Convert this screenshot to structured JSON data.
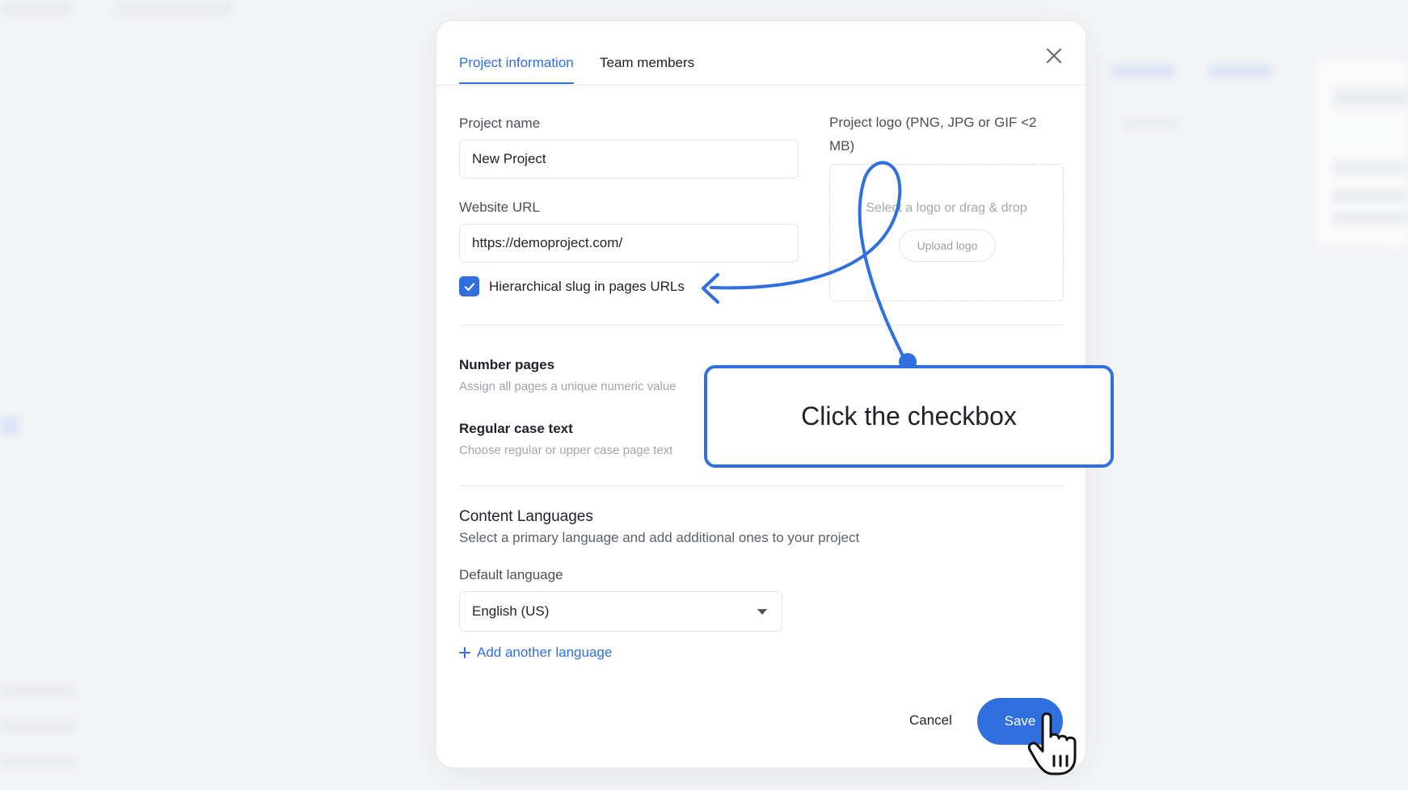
{
  "tabs": [
    {
      "label": "Project information",
      "active": true
    },
    {
      "label": "Team members",
      "active": false
    }
  ],
  "form": {
    "project_name_label": "Project name",
    "project_name_value": "New Project",
    "website_url_label": "Website URL",
    "website_url_value": "https://demoproject.com/",
    "hierarchical_slug_label": "Hierarchical slug in pages URLs",
    "hierarchical_slug_checked": true,
    "logo_label": "Project logo (PNG, JPG or GIF <2 MB)",
    "logo_dropzone_text": "Select a logo or drag & drop",
    "upload_logo_label": "Upload logo"
  },
  "settings": [
    {
      "title": "Number pages",
      "description": "Assign all pages a unique numeric value"
    },
    {
      "title": "Regular case text",
      "description": "Choose regular or upper case page text"
    }
  ],
  "languages": {
    "title": "Content Languages",
    "subtitle": "Select a primary language and add additional ones to your project",
    "default_label": "Default language",
    "default_value": "English (US)",
    "add_label": "Add another language"
  },
  "footer": {
    "cancel_label": "Cancel",
    "save_label": "Save"
  },
  "callout": {
    "text": "Click the checkbox"
  },
  "colors": {
    "accent": "#2f6fde"
  }
}
